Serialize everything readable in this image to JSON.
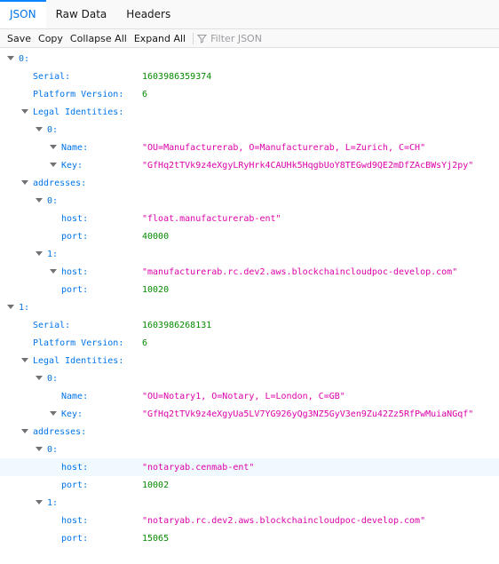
{
  "tabs": [
    "JSON",
    "Raw Data",
    "Headers"
  ],
  "toolbar": {
    "save": "Save",
    "copy": "Copy",
    "collapse_all": "Collapse All",
    "expand_all": "Expand All",
    "filter_placeholder": "Filter JSON"
  },
  "tree": {
    "n0": {
      "key": "0:",
      "serial": {
        "key": "Serial:",
        "value": "1603986359374"
      },
      "platform": {
        "key": "Platform Version:",
        "value": "6"
      },
      "legal": {
        "key": "Legal Identities:",
        "i0": {
          "key": "0:",
          "name": {
            "key": "Name:",
            "value": "\"OU=Manufacturerab, O=Manufacturerab, L=Zurich, C=CH\""
          },
          "idkey": {
            "key": "Key:",
            "value": "\"GfHq2tTVk9z4eXgyLRyHrk4CAUHk5HqgbUoY8TEGwd9QE2mDfZAcBWsYj2py\""
          }
        }
      },
      "addresses": {
        "key": "addresses:",
        "a0": {
          "key": "0:",
          "host": {
            "key": "host:",
            "value": "\"float.manufacturerab-ent\""
          },
          "port": {
            "key": "port:",
            "value": "40000"
          }
        },
        "a1": {
          "key": "1:",
          "host": {
            "key": "host:",
            "value": "\"manufacturerab.rc.dev2.aws.blockchaincloudpoc-develop.com\""
          },
          "port": {
            "key": "port:",
            "value": "10020"
          }
        }
      }
    },
    "n1": {
      "key": "1:",
      "serial": {
        "key": "Serial:",
        "value": "1603986268131"
      },
      "platform": {
        "key": "Platform Version:",
        "value": "6"
      },
      "legal": {
        "key": "Legal Identities:",
        "i0": {
          "key": "0:",
          "name": {
            "key": "Name:",
            "value": "\"OU=Notary1, O=Notary, L=London, C=GB\""
          },
          "idkey": {
            "key": "Key:",
            "value": "\"GfHq2tTVk9z4eXgyUa5LV7YG926yQg3NZ5GyV3en9Zu42Zz5RfPwMuiaNGqf\""
          }
        }
      },
      "addresses": {
        "key": "addresses:",
        "a0": {
          "key": "0:",
          "host": {
            "key": "host:",
            "value": "\"notaryab.cenmab-ent\""
          },
          "port": {
            "key": "port:",
            "value": "10002"
          }
        },
        "a1": {
          "key": "1:",
          "host": {
            "key": "host:",
            "value": "\"notaryab.rc.dev2.aws.blockchaincloudpoc-develop.com\""
          },
          "port": {
            "key": "port:",
            "value": "15065"
          }
        }
      }
    }
  }
}
